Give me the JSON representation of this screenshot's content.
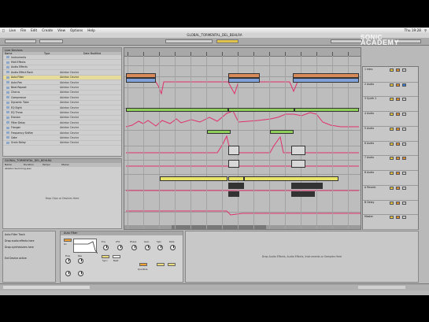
{
  "menubar": {
    "apple": "",
    "items": [
      "Live",
      "File",
      "Edit",
      "Create",
      "View",
      "Options",
      "Help"
    ],
    "clock": "Thu 19:28"
  },
  "window": {
    "title": "GLOBAL_TORMENTAL_DEL_BEHLRA"
  },
  "watermark": {
    "line1": "SONIC",
    "line2": "ACADEMY"
  },
  "browser": {
    "header": "Live Devices",
    "columns": [
      "Name",
      "Type",
      "Date Modified"
    ],
    "items": [
      {
        "name": "Instruments",
        "type": ""
      },
      {
        "name": "Midi Effects",
        "type": ""
      },
      {
        "name": "Audio Effects",
        "type": ""
      },
      {
        "name": "Audio Effect Rack",
        "type": "Ableton Device"
      },
      {
        "name": "Auto Filter",
        "type": "Ableton Device",
        "selected": true
      },
      {
        "name": "Auto Pan",
        "type": "Ableton Device"
      },
      {
        "name": "Beat Repeat",
        "type": "Ableton Device"
      },
      {
        "name": "Chorus",
        "type": "Ableton Device"
      },
      {
        "name": "Compressor",
        "type": "Ableton Device"
      },
      {
        "name": "Dynamic Tube",
        "type": "Ableton Device"
      },
      {
        "name": "EQ Eight",
        "type": "Ableton Device"
      },
      {
        "name": "EQ Three",
        "type": "Ableton Device"
      },
      {
        "name": "Erosion",
        "type": "Ableton Device"
      },
      {
        "name": "Filter Delay",
        "type": "Ableton Device"
      },
      {
        "name": "Flanger",
        "type": "Ableton Device"
      },
      {
        "name": "Frequency Shifter",
        "type": "Ableton Device"
      },
      {
        "name": "Gate",
        "type": "Ableton Device"
      },
      {
        "name": "Grain Delay",
        "type": "Ableton Device"
      }
    ]
  },
  "clipview": {
    "header": "GLOBAL_TORMENTAL_DEL_BEHLRA",
    "columns": [
      "Name",
      "Duration",
      "Tempo",
      "Stereo"
    ],
    "row": "Ableton Summing.wav",
    "hint": "Drop Clips or Devices Here"
  },
  "devices_left": {
    "lines": [
      "Auto Filter Track",
      "Drop audio effects here",
      "Drop synthesizers here"
    ],
    "extra": "Ext Device active"
  },
  "device": {
    "name": "Auto Filter",
    "labels": [
      "Freq",
      "Res",
      "Env",
      "LFO",
      "Phase",
      "Gain",
      "Spin",
      "Rate",
      "Quantize"
    ],
    "buttons": [
      "On",
      "Sync",
      "Beat"
    ]
  },
  "devdrop": {
    "message": "Drop Audio Effects, Audio Effects, Instruments or Samples Here"
  },
  "mixer": {
    "strips": [
      {
        "name": "1 Intro",
        "colors": [
          "y",
          "o",
          "g"
        ]
      },
      {
        "name": "2 Audio",
        "colors": [
          "y",
          "o",
          "b"
        ]
      },
      {
        "name": "3 Synth 2",
        "colors": [
          "y",
          "o",
          "g"
        ]
      },
      {
        "name": "4 Audio",
        "colors": [
          "y",
          "o",
          "g"
        ]
      },
      {
        "name": "5 Audio",
        "colors": [
          "y",
          "o",
          "g"
        ]
      },
      {
        "name": "6 Audio",
        "colors": [
          "y",
          "o",
          "g"
        ]
      },
      {
        "name": "7 Audio",
        "colors": [
          "y",
          "o",
          "o"
        ]
      },
      {
        "name": "8 Audio",
        "colors": [
          "y",
          "o",
          "g"
        ]
      },
      {
        "name": "A Reverb",
        "colors": [
          "y",
          "o",
          "g"
        ]
      },
      {
        "name": "B Delay",
        "colors": [
          "y",
          "o",
          "g"
        ]
      },
      {
        "name": "Master",
        "colors": [
          "y",
          "o",
          "g"
        ]
      }
    ]
  },
  "colors": {
    "automation": "#e0306a",
    "clip_orange": "#d98a5a",
    "clip_green": "#8fce5a",
    "clip_yellow": "#e8e468",
    "clip_blue": "#7fa0d8"
  }
}
